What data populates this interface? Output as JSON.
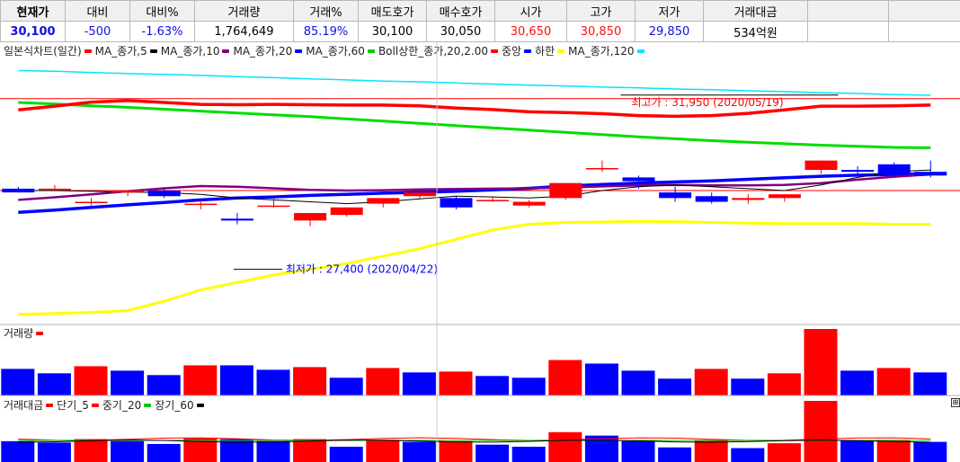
{
  "quote": {
    "headers": [
      "현재가",
      "대비",
      "대비%",
      "거래량",
      "거래%",
      "매도호가",
      "매수호가",
      "시가",
      "고가",
      "저가",
      "거래대금"
    ],
    "values": [
      {
        "text": "30,100",
        "color": "#1010e0"
      },
      {
        "text": "-500",
        "color": "#1010e0"
      },
      {
        "text": "-1.63%",
        "color": "#1010e0"
      },
      {
        "text": "1,764,649",
        "color": "#000000"
      },
      {
        "text": "85.19%",
        "color": "#1010e0"
      },
      {
        "text": "30,100",
        "color": "#000000"
      },
      {
        "text": "30,050",
        "color": "#000000"
      },
      {
        "text": "30,650",
        "color": "#ff1010"
      },
      {
        "text": "30,850",
        "color": "#ff1010"
      },
      {
        "text": "29,850",
        "color": "#1010e0"
      },
      {
        "text": "534억원",
        "color": "#000000"
      }
    ]
  },
  "price_legend": [
    {
      "label": "일본식차트(일간)",
      "color": "#ff0000"
    },
    {
      "label": "MA_종가,5",
      "color": "#000000"
    },
    {
      "label": "MA_종가,10",
      "color": "#800080"
    },
    {
      "label": "MA_종가,20",
      "color": "#0000ff"
    },
    {
      "label": "MA_종가,60",
      "color": "#00cc00"
    },
    {
      "label": "Boll상한_종가,20,2.00",
      "color": "#ff0000"
    },
    {
      "label": "중앙",
      "color": "#0000ff"
    },
    {
      "label": "하한",
      "color": "#ffff00"
    },
    {
      "label": "MA_종가,120",
      "color": "#00e5ff"
    }
  ],
  "volume_legend": [
    {
      "label": "거래량",
      "color": "#ff0000"
    }
  ],
  "amount_legend": [
    {
      "label": "거래대금",
      "color": "#ff0000"
    },
    {
      "label": "단기_5",
      "color": "#ff0000"
    },
    {
      "label": "중기_20",
      "color": "#00cc00"
    },
    {
      "label": "장기_60",
      "color": "#000000"
    }
  ],
  "annotations": {
    "high": "최고가 : 31,950 (2020/05/19)",
    "low": "최저가 : 27,400 (2020/04/22)"
  },
  "chart_data": {
    "type": "candlestick",
    "candles": [
      {
        "o": 29550,
        "h": 29600,
        "l": 29450,
        "c": 29450
      },
      {
        "o": 29550,
        "h": 29650,
        "l": 29480,
        "c": 29550
      },
      {
        "o": 29200,
        "h": 29300,
        "l": 29100,
        "c": 29200
      },
      {
        "o": 29450,
        "h": 29500,
        "l": 29350,
        "c": 29500
      },
      {
        "o": 29500,
        "h": 29550,
        "l": 29300,
        "c": 29350
      },
      {
        "o": 29150,
        "h": 29250,
        "l": 29000,
        "c": 29150
      },
      {
        "o": 28750,
        "h": 28900,
        "l": 28600,
        "c": 28700
      },
      {
        "o": 29100,
        "h": 29300,
        "l": 29050,
        "c": 29100
      },
      {
        "o": 28700,
        "h": 28800,
        "l": 28550,
        "c": 28900
      },
      {
        "o": 28850,
        "h": 29050,
        "l": 28800,
        "c": 29050
      },
      {
        "o": 29150,
        "h": 29300,
        "l": 29050,
        "c": 29300
      },
      {
        "o": 29350,
        "h": 29450,
        "l": 29250,
        "c": 29450
      },
      {
        "o": 29300,
        "h": 29350,
        "l": 29000,
        "c": 29050
      },
      {
        "o": 29250,
        "h": 29350,
        "l": 29200,
        "c": 29250
      },
      {
        "o": 29100,
        "h": 29250,
        "l": 29050,
        "c": 29200
      },
      {
        "o": 29300,
        "h": 29700,
        "l": 29250,
        "c": 29700
      },
      {
        "o": 30100,
        "h": 30300,
        "l": 30000,
        "c": 30100
      },
      {
        "o": 29850,
        "h": 29900,
        "l": 29550,
        "c": 29750
      },
      {
        "o": 29450,
        "h": 29600,
        "l": 29200,
        "c": 29300
      },
      {
        "o": 29350,
        "h": 29450,
        "l": 29150,
        "c": 29200
      },
      {
        "o": 29250,
        "h": 29400,
        "l": 29150,
        "c": 29300
      },
      {
        "o": 29300,
        "h": 29400,
        "l": 29200,
        "c": 29400
      },
      {
        "o": 30050,
        "h": 30300,
        "l": 29950,
        "c": 30300
      },
      {
        "o": 30050,
        "h": 30150,
        "l": 29950,
        "c": 30000
      },
      {
        "o": 30200,
        "h": 30250,
        "l": 29850,
        "c": 29950
      },
      {
        "o": 30000,
        "h": 30300,
        "l": 29850,
        "c": 29900
      }
    ],
    "volume": [
      {
        "v": 300,
        "up": false
      },
      {
        "v": 250,
        "up": false
      },
      {
        "v": 330,
        "up": true
      },
      {
        "v": 280,
        "up": false
      },
      {
        "v": 230,
        "up": false
      },
      {
        "v": 340,
        "up": true
      },
      {
        "v": 340,
        "up": false
      },
      {
        "v": 290,
        "up": false
      },
      {
        "v": 320,
        "up": true
      },
      {
        "v": 200,
        "up": false
      },
      {
        "v": 310,
        "up": true
      },
      {
        "v": 260,
        "up": false
      },
      {
        "v": 270,
        "up": true
      },
      {
        "v": 220,
        "up": false
      },
      {
        "v": 200,
        "up": false
      },
      {
        "v": 400,
        "up": true
      },
      {
        "v": 360,
        "up": false
      },
      {
        "v": 280,
        "up": false
      },
      {
        "v": 190,
        "up": false
      },
      {
        "v": 300,
        "up": true
      },
      {
        "v": 190,
        "up": false
      },
      {
        "v": 250,
        "up": true
      },
      {
        "v": 750,
        "up": true
      },
      {
        "v": 280,
        "up": false
      },
      {
        "v": 310,
        "up": true
      },
      {
        "v": 260,
        "up": false
      }
    ],
    "amount": [
      {
        "v": 300,
        "up": false
      },
      {
        "v": 280,
        "up": false
      },
      {
        "v": 330,
        "up": true
      },
      {
        "v": 300,
        "up": false
      },
      {
        "v": 260,
        "up": false
      },
      {
        "v": 340,
        "up": true
      },
      {
        "v": 330,
        "up": false
      },
      {
        "v": 300,
        "up": false
      },
      {
        "v": 330,
        "up": true
      },
      {
        "v": 220,
        "up": false
      },
      {
        "v": 320,
        "up": true
      },
      {
        "v": 290,
        "up": false
      },
      {
        "v": 300,
        "up": true
      },
      {
        "v": 250,
        "up": false
      },
      {
        "v": 220,
        "up": false
      },
      {
        "v": 430,
        "up": true
      },
      {
        "v": 380,
        "up": false
      },
      {
        "v": 300,
        "up": false
      },
      {
        "v": 210,
        "up": false
      },
      {
        "v": 310,
        "up": true
      },
      {
        "v": 200,
        "up": false
      },
      {
        "v": 270,
        "up": true
      },
      {
        "v": 880,
        "up": true
      },
      {
        "v": 310,
        "up": false
      },
      {
        "v": 320,
        "up": true
      },
      {
        "v": 290,
        "up": false
      }
    ],
    "indicators": {
      "ma120": [
        32700,
        32680,
        32650,
        32620,
        32600,
        32570,
        32540,
        32510,
        32480,
        32450,
        32420,
        32400,
        32370,
        32340,
        32310,
        32290,
        32260,
        32240,
        32210,
        32190,
        32160,
        32140,
        32110,
        32090,
        32060,
        32040
      ],
      "ma60": [
        31850,
        31810,
        31760,
        31720,
        31670,
        31620,
        31570,
        31520,
        31470,
        31410,
        31350,
        31290,
        31230,
        31170,
        31110,
        31050,
        30990,
        30930,
        30880,
        30830,
        30790,
        30750,
        30710,
        30680,
        30650,
        30640
      ],
      "boll_upper": [
        31650,
        31750,
        31860,
        31900,
        31850,
        31800,
        31790,
        31800,
        31790,
        31780,
        31780,
        31760,
        31700,
        31660,
        31600,
        31580,
        31550,
        31500,
        31480,
        31500,
        31560,
        31650,
        31750,
        31750,
        31760,
        31780
      ],
      "boll_middle": [
        28920,
        28980,
        29050,
        29120,
        29180,
        29250,
        29300,
        29330,
        29370,
        29400,
        29430,
        29450,
        29480,
        29520,
        29560,
        29620,
        29660,
        29700,
        29730,
        29760,
        29800,
        29840,
        29880,
        29910,
        29930,
        29950
      ],
      "boll_lower": [
        26200,
        26220,
        26250,
        26300,
        26550,
        26850,
        27050,
        27250,
        27400,
        27550,
        27750,
        27950,
        28200,
        28450,
        28600,
        28650,
        28660,
        28680,
        28670,
        28650,
        28630,
        28620,
        28620,
        28620,
        28600,
        28600
      ],
      "ma10": [
        29250,
        29320,
        29400,
        29480,
        29560,
        29620,
        29600,
        29560,
        29520,
        29500,
        29510,
        29530,
        29540,
        29550,
        29560,
        29580,
        29610,
        29640,
        29650,
        29640,
        29640,
        29650,
        29700,
        29790,
        29870,
        29930
      ],
      "ma5": [
        29500,
        29500,
        29480,
        29460,
        29450,
        29400,
        29300,
        29250,
        29200,
        29150,
        29200,
        29280,
        29350,
        29330,
        29300,
        29350,
        29500,
        29600,
        29650,
        29600,
        29550,
        29500,
        29650,
        29850,
        30000,
        30050
      ]
    },
    "ylim": [
      26000,
      33000
    ],
    "high_line": 31950,
    "low_mark": 27400
  }
}
